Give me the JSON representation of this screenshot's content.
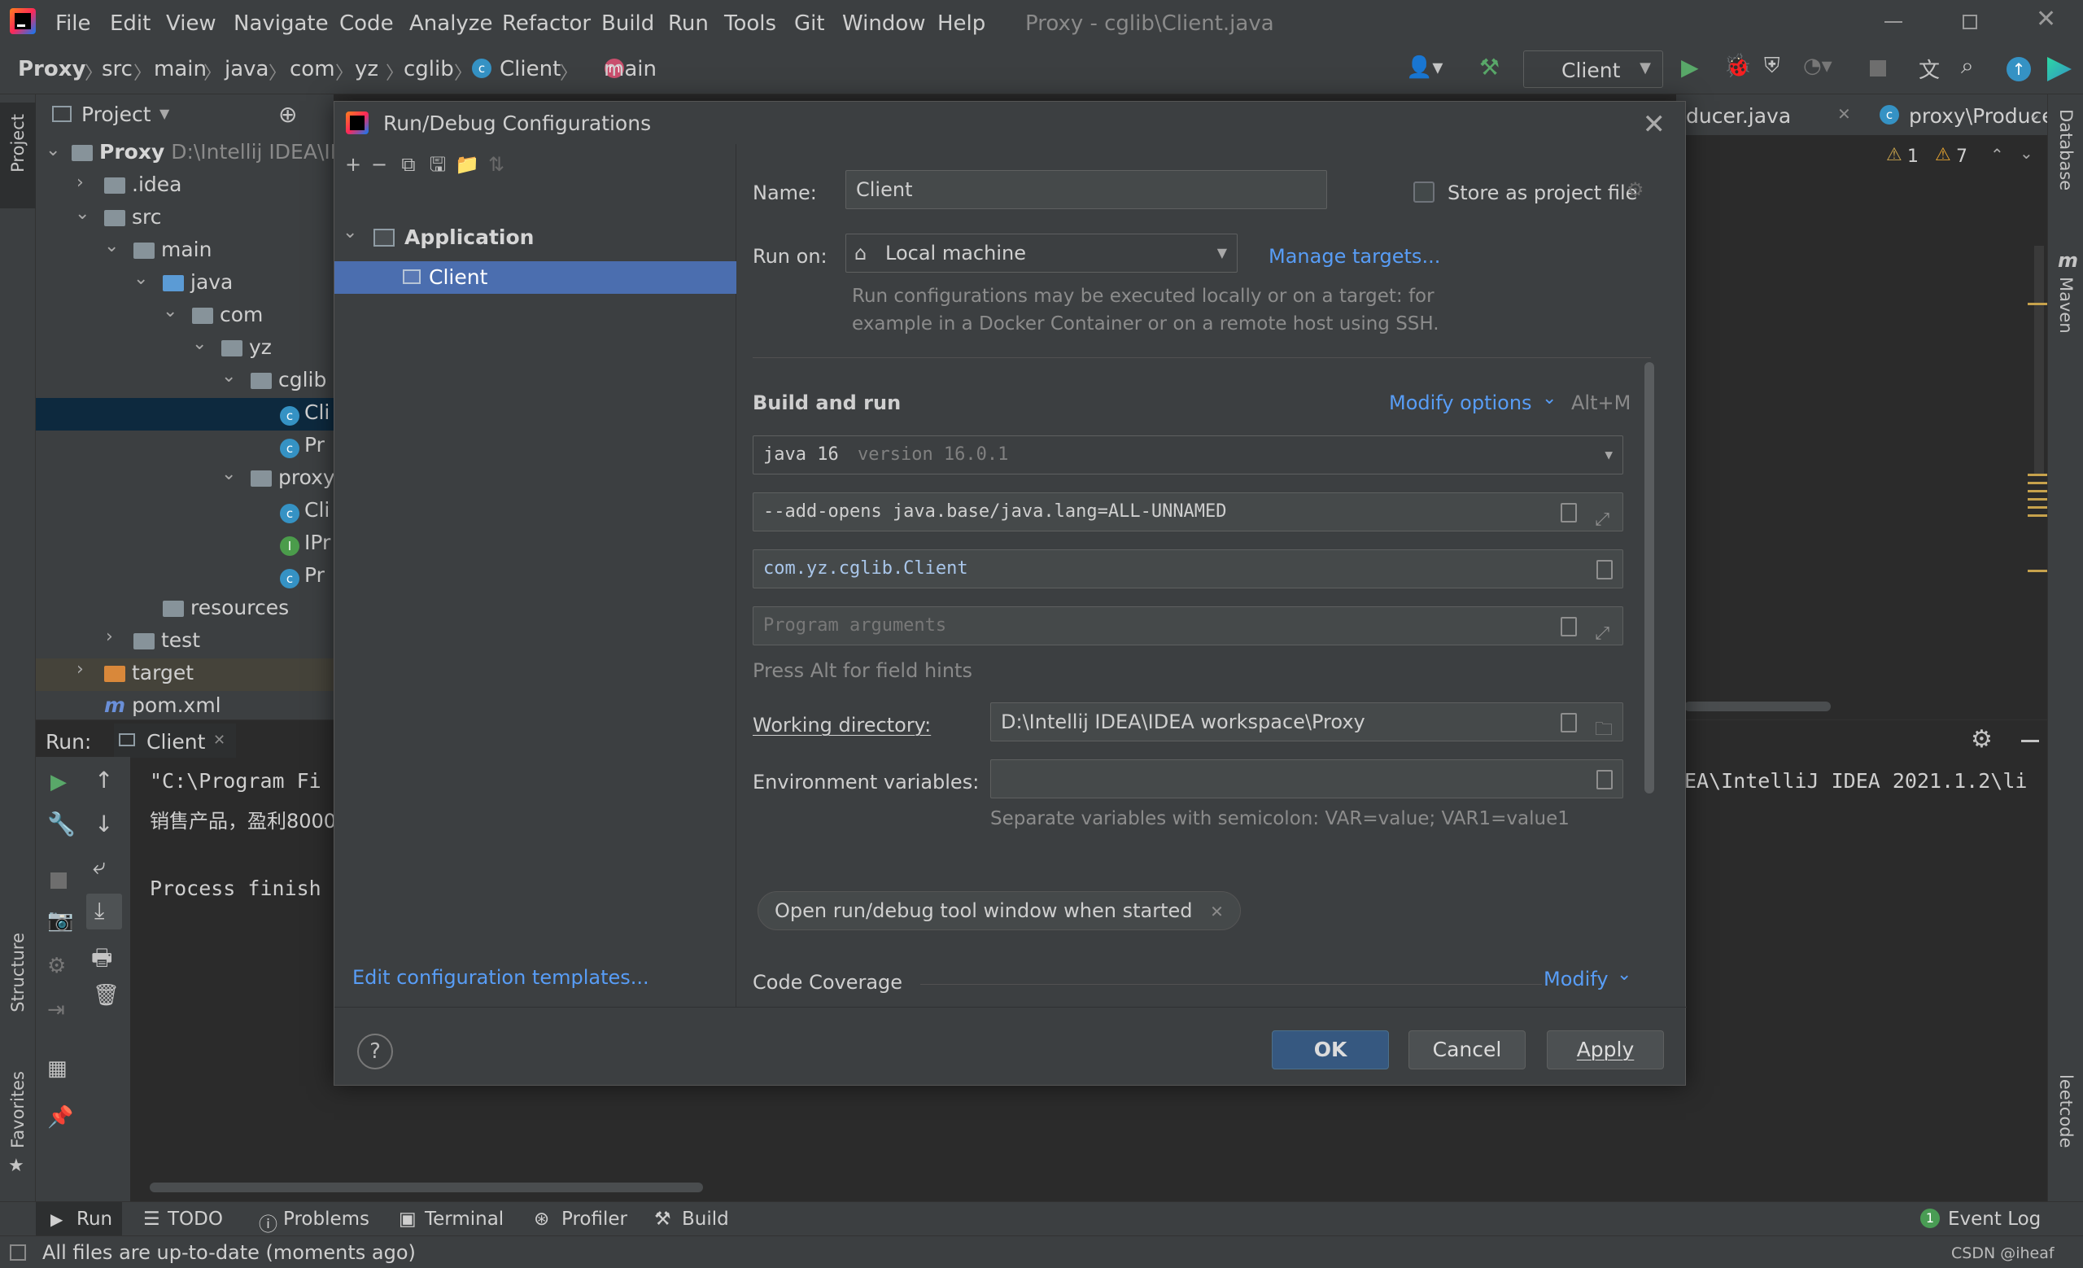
{
  "menubar": {
    "items": [
      "File",
      "Edit",
      "View",
      "Navigate",
      "Code",
      "Analyze",
      "Refactor",
      "Build",
      "Run",
      "Tools",
      "Git",
      "Window",
      "Help"
    ],
    "window_title": "Proxy - cglib\\Client.java"
  },
  "navbar": {
    "crumbs": [
      "Proxy",
      "src",
      "main",
      "java",
      "com",
      "yz",
      "cglib",
      "Client",
      "main"
    ],
    "run_config": "Client"
  },
  "editor_tabs": [
    "ducer.java",
    "proxy\\Produce"
  ],
  "editor_warnings": {
    "weak": "1",
    "warn": "7"
  },
  "project_panel": {
    "title": "Project",
    "root": "Proxy",
    "root_path": "D:\\Intellij IDEA\\ID",
    "items": [
      ".idea",
      "src",
      "main",
      "java",
      "com",
      "yz",
      "cglib",
      "Cli",
      "Pr",
      "proxy",
      "Cli",
      "IPr",
      "Pr",
      "resources",
      "test",
      "target",
      "pom.xml"
    ]
  },
  "side_tabs": {
    "left": [
      "Project",
      "Structure",
      "Favorites"
    ],
    "right": [
      "Database",
      "Maven",
      "leetcode"
    ]
  },
  "run_panel": {
    "label": "Run:",
    "tab": "Client",
    "line1": "\"C:\\Program Fi",
    "line2": "销售产品，盈利8000",
    "line3": "Process finish",
    "line1_right": "EA\\IntelliJ IDEA 2021.1.2\\li"
  },
  "bottom_tabs": [
    "Run",
    "TODO",
    "Problems",
    "Terminal",
    "Profiler",
    "Build"
  ],
  "event_log": {
    "label": "Event Log",
    "count": "1"
  },
  "status": {
    "text": "All files are up-to-date (moments ago)",
    "watermark": "CSDN @iheaf"
  },
  "dialog": {
    "title": "Run/Debug Configurations",
    "tree_group": "Application",
    "tree_item": "Client",
    "edit_templates": "Edit configuration templates...",
    "name_label": "Name:",
    "name_value": "Client",
    "store_label": "Store as project file",
    "run_on_label": "Run on:",
    "run_on_value": "Local machine",
    "manage_targets": "Manage targets...",
    "run_on_hint_1": "Run configurations may be executed locally or on a target: for",
    "run_on_hint_2": "example in a Docker Container or on a remote host using SSH.",
    "build_run_title": "Build and run",
    "modify_options": "Modify options",
    "modify_shortcut": "Alt+M",
    "jre_value": "java 16",
    "jre_version": "version 16.0.1",
    "vm_options": "--add-opens java.base/java.lang=ALL-UNNAMED",
    "main_class": "com.yz.cglib.Client",
    "program_args_placeholder": "Program arguments",
    "field_hint": "Press Alt for field hints",
    "working_dir_label": "Working directory:",
    "working_dir_value": "D:\\Intellij IDEA\\IDEA workspace\\Proxy",
    "env_label": "Environment variables:",
    "env_value": "",
    "env_hint": "Separate variables with semicolon: VAR=value; VAR1=value1",
    "open_tool_window_chip": "Open run/debug tool window when started",
    "code_coverage": "Code Coverage",
    "modify": "Modify",
    "ok": "OK",
    "cancel": "Cancel",
    "apply": "Apply",
    "help": "?"
  },
  "colors": {
    "accent": "#4b6eaf",
    "link": "#589df6",
    "ok_button": "#365880",
    "run_green": "#59a869"
  }
}
